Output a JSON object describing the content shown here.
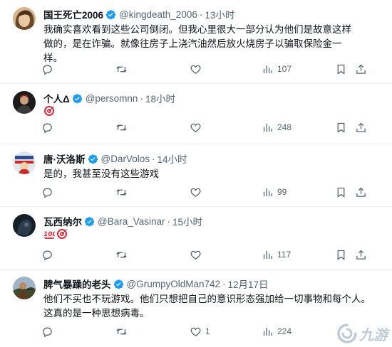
{
  "tweets": [
    {
      "name": "国王死亡2006",
      "handle": "@kingdeath_2006",
      "time": "13小时",
      "text": [
        "我确实喜欢看到这些公司倒闭。但我心里很大一部分认为他们是故意这样做的，是在诈骗。就像往房子上浇汽油然后放火烧房子以骗取保险金一样。"
      ],
      "emoji": [],
      "replies": "",
      "retweets": "",
      "likes": "",
      "views": "107"
    },
    {
      "name": "个人Δ",
      "handle": "@persomnn",
      "time": "18小时",
      "text": [],
      "emoji": [
        "direct-hit"
      ],
      "replies": "",
      "retweets": "",
      "likes": "",
      "views": "248"
    },
    {
      "name": "唐·沃洛斯",
      "handle": "@DarVolos",
      "time": "14小时",
      "text": [
        "是的，我甚至没有这些游戏"
      ],
      "emoji": [],
      "replies": "",
      "retweets": "",
      "likes": "",
      "views": "99"
    },
    {
      "name": "瓦西纳尔",
      "handle": "@Bara_Vasinar",
      "time": "15小时",
      "text": [],
      "emoji": [
        "hundred-points",
        "direct-hit"
      ],
      "replies": "",
      "retweets": "",
      "likes": "",
      "views": "117"
    },
    {
      "name": "脾气暴躁的老头",
      "handle": "@GrumpyOldMan742",
      "time": "12月17日",
      "text": [
        "他们不买也不玩游戏。他们只想把自己的意识形态强加给一切事物和每个人。",
        "这真的是一种思想病毒。"
      ],
      "emoji": [],
      "replies": "",
      "retweets": "",
      "likes": "1",
      "views": "224"
    }
  ],
  "separator": "·",
  "watermark": "九游",
  "colors": {
    "verified": "#1d9bf0",
    "muted": "#536471",
    "text": "#0f1419",
    "border": "#eff3f4"
  }
}
